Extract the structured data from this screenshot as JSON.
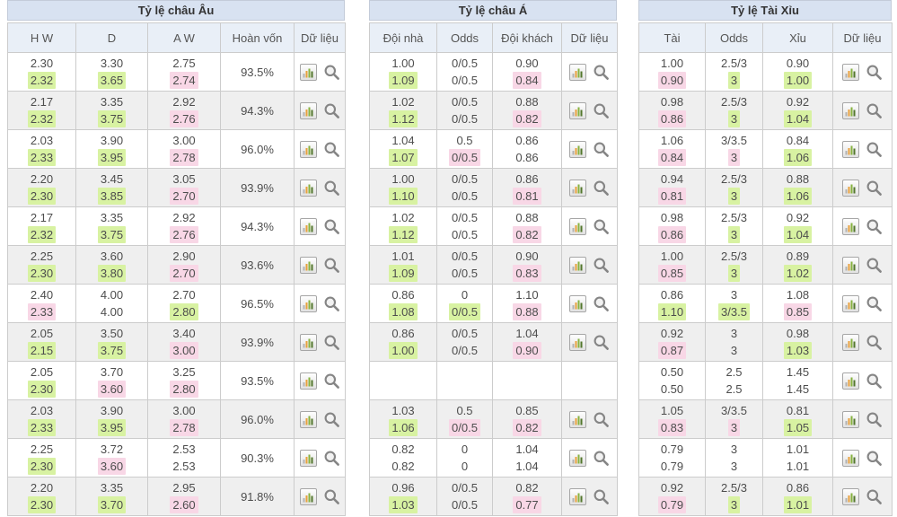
{
  "colors": {
    "highlight_green": "#d8f2a2",
    "highlight_pink": "#f8d7e6",
    "title_bg": "#d8e2f1",
    "header_bg": "#e9eff7",
    "alt_row_bg": "#efefef"
  },
  "icons": {
    "chart": "bar-chart-icon",
    "search": "magnifier-icon"
  },
  "tables": [
    {
      "key": "european-odds",
      "title": "Tỷ lệ châu Âu",
      "headers": [
        "H W",
        "D",
        "A W",
        "Hoàn vốn",
        "Dữ liệu"
      ],
      "rows": [
        {
          "vals": [
            [
              "2.30",
              "2.32",
              "g"
            ],
            [
              "3.30",
              "3.65",
              "g"
            ],
            [
              "2.75",
              "2.74",
              "p"
            ]
          ],
          "ret": "93.5%"
        },
        {
          "vals": [
            [
              "2.17",
              "2.32",
              "g"
            ],
            [
              "3.35",
              "3.75",
              "g"
            ],
            [
              "2.92",
              "2.76",
              "p"
            ]
          ],
          "ret": "94.3%"
        },
        {
          "vals": [
            [
              "2.03",
              "2.33",
              "g"
            ],
            [
              "3.90",
              "3.95",
              "g"
            ],
            [
              "3.00",
              "2.78",
              "p"
            ]
          ],
          "ret": "96.0%"
        },
        {
          "vals": [
            [
              "2.20",
              "2.30",
              "g"
            ],
            [
              "3.45",
              "3.85",
              "g"
            ],
            [
              "3.05",
              "2.70",
              "p"
            ]
          ],
          "ret": "93.9%"
        },
        {
          "vals": [
            [
              "2.17",
              "2.32",
              "g"
            ],
            [
              "3.35",
              "3.75",
              "g"
            ],
            [
              "2.92",
              "2.76",
              "p"
            ]
          ],
          "ret": "94.3%"
        },
        {
          "vals": [
            [
              "2.25",
              "2.30",
              "g"
            ],
            [
              "3.60",
              "3.80",
              "g"
            ],
            [
              "2.90",
              "2.70",
              "p"
            ]
          ],
          "ret": "93.6%"
        },
        {
          "vals": [
            [
              "2.40",
              "2.33",
              "p"
            ],
            [
              "4.00",
              "4.00",
              ""
            ],
            [
              "2.70",
              "2.80",
              "g"
            ]
          ],
          "ret": "96.5%"
        },
        {
          "vals": [
            [
              "2.05",
              "2.15",
              "g"
            ],
            [
              "3.50",
              "3.75",
              "g"
            ],
            [
              "3.40",
              "3.00",
              "p"
            ]
          ],
          "ret": "93.9%"
        },
        {
          "vals": [
            [
              "2.05",
              "2.30",
              "g"
            ],
            [
              "3.70",
              "3.60",
              "p"
            ],
            [
              "3.25",
              "2.80",
              "p"
            ]
          ],
          "ret": "93.5%"
        },
        {
          "vals": [
            [
              "2.03",
              "2.33",
              "g"
            ],
            [
              "3.90",
              "3.95",
              "g"
            ],
            [
              "3.00",
              "2.78",
              "p"
            ]
          ],
          "ret": "96.0%"
        },
        {
          "vals": [
            [
              "2.25",
              "2.30",
              "g"
            ],
            [
              "3.72",
              "3.60",
              "p"
            ],
            [
              "2.53",
              "2.53",
              ""
            ]
          ],
          "ret": "90.3%"
        },
        {
          "vals": [
            [
              "2.20",
              "2.30",
              "g"
            ],
            [
              "3.35",
              "3.70",
              "g"
            ],
            [
              "2.95",
              "2.60",
              "p"
            ]
          ],
          "ret": "91.8%"
        }
      ]
    },
    {
      "key": "asian-odds",
      "title": "Tỷ lệ châu Á",
      "headers": [
        "Đội nhà",
        "Odds",
        "Đội khách",
        "Dữ liệu"
      ],
      "rows": [
        {
          "vals": [
            [
              "1.00",
              "1.09",
              "g"
            ],
            [
              "0/0.5",
              "0/0.5",
              ""
            ],
            [
              "0.90",
              "0.84",
              "p"
            ]
          ]
        },
        {
          "vals": [
            [
              "1.02",
              "1.12",
              "g"
            ],
            [
              "0/0.5",
              "0/0.5",
              ""
            ],
            [
              "0.88",
              "0.82",
              "p"
            ]
          ]
        },
        {
          "vals": [
            [
              "1.04",
              "1.07",
              "g"
            ],
            [
              "0.5",
              "0/0.5",
              "p"
            ],
            [
              "0.86",
              "0.86",
              ""
            ]
          ]
        },
        {
          "vals": [
            [
              "1.00",
              "1.10",
              "g"
            ],
            [
              "0/0.5",
              "0/0.5",
              ""
            ],
            [
              "0.86",
              "0.81",
              "p"
            ]
          ]
        },
        {
          "vals": [
            [
              "1.02",
              "1.12",
              "g"
            ],
            [
              "0/0.5",
              "0/0.5",
              ""
            ],
            [
              "0.88",
              "0.82",
              "p"
            ]
          ]
        },
        {
          "vals": [
            [
              "1.01",
              "1.09",
              "g"
            ],
            [
              "0/0.5",
              "0/0.5",
              ""
            ],
            [
              "0.90",
              "0.83",
              "p"
            ]
          ]
        },
        {
          "vals": [
            [
              "0.86",
              "1.08",
              "g"
            ],
            [
              "0",
              "0/0.5",
              "g"
            ],
            [
              "1.10",
              "0.88",
              "p"
            ]
          ]
        },
        {
          "vals": [
            [
              "0.86",
              "1.00",
              "g"
            ],
            [
              "0/0.5",
              "0/0.5",
              ""
            ],
            [
              "1.04",
              "0.90",
              "p"
            ]
          ]
        },
        {
          "empty": true
        },
        {
          "vals": [
            [
              "1.03",
              "1.06",
              "g"
            ],
            [
              "0.5",
              "0/0.5",
              "p"
            ],
            [
              "0.85",
              "0.82",
              "p"
            ]
          ]
        },
        {
          "vals": [
            [
              "0.82",
              "0.82",
              ""
            ],
            [
              "0",
              "0",
              ""
            ],
            [
              "1.04",
              "1.04",
              ""
            ]
          ]
        },
        {
          "vals": [
            [
              "0.96",
              "1.03",
              "g"
            ],
            [
              "0/0.5",
              "0/0.5",
              ""
            ],
            [
              "0.82",
              "0.77",
              "p"
            ]
          ]
        }
      ]
    },
    {
      "key": "over-under-odds",
      "title": "Tỷ lệ Tài Xỉu",
      "headers": [
        "Tài",
        "Odds",
        "Xỉu",
        "Dữ liệu"
      ],
      "rows": [
        {
          "vals": [
            [
              "1.00",
              "0.90",
              "p"
            ],
            [
              "2.5/3",
              "3",
              "g"
            ],
            [
              "0.90",
              "1.00",
              "g"
            ]
          ]
        },
        {
          "vals": [
            [
              "0.98",
              "0.86",
              "p"
            ],
            [
              "2.5/3",
              "3",
              "g"
            ],
            [
              "0.92",
              "1.04",
              "g"
            ]
          ]
        },
        {
          "vals": [
            [
              "1.06",
              "0.84",
              "p"
            ],
            [
              "3/3.5",
              "3",
              "p"
            ],
            [
              "0.84",
              "1.06",
              "g"
            ]
          ]
        },
        {
          "vals": [
            [
              "0.94",
              "0.81",
              "p"
            ],
            [
              "2.5/3",
              "3",
              "g"
            ],
            [
              "0.88",
              "1.06",
              "g"
            ]
          ]
        },
        {
          "vals": [
            [
              "0.98",
              "0.86",
              "p"
            ],
            [
              "2.5/3",
              "3",
              "g"
            ],
            [
              "0.92",
              "1.04",
              "g"
            ]
          ]
        },
        {
          "vals": [
            [
              "1.00",
              "0.85",
              "p"
            ],
            [
              "2.5/3",
              "3",
              "g"
            ],
            [
              "0.89",
              "1.02",
              "g"
            ]
          ]
        },
        {
          "vals": [
            [
              "0.86",
              "1.10",
              "g"
            ],
            [
              "3",
              "3/3.5",
              "g"
            ],
            [
              "1.08",
              "0.85",
              "p"
            ]
          ]
        },
        {
          "vals": [
            [
              "0.92",
              "0.87",
              "p"
            ],
            [
              "3",
              "3",
              ""
            ],
            [
              "0.98",
              "1.03",
              "g"
            ]
          ]
        },
        {
          "vals": [
            [
              "0.50",
              "0.50",
              ""
            ],
            [
              "2.5",
              "2.5",
              ""
            ],
            [
              "1.45",
              "1.45",
              ""
            ]
          ]
        },
        {
          "vals": [
            [
              "1.05",
              "0.83",
              "p"
            ],
            [
              "3/3.5",
              "3",
              "p"
            ],
            [
              "0.81",
              "1.05",
              "g"
            ]
          ]
        },
        {
          "vals": [
            [
              "0.79",
              "0.79",
              ""
            ],
            [
              "3",
              "3",
              ""
            ],
            [
              "1.01",
              "1.01",
              ""
            ]
          ]
        },
        {
          "vals": [
            [
              "0.92",
              "0.79",
              "p"
            ],
            [
              "2.5/3",
              "3",
              "g"
            ],
            [
              "0.86",
              "1.01",
              "g"
            ]
          ]
        }
      ]
    }
  ]
}
